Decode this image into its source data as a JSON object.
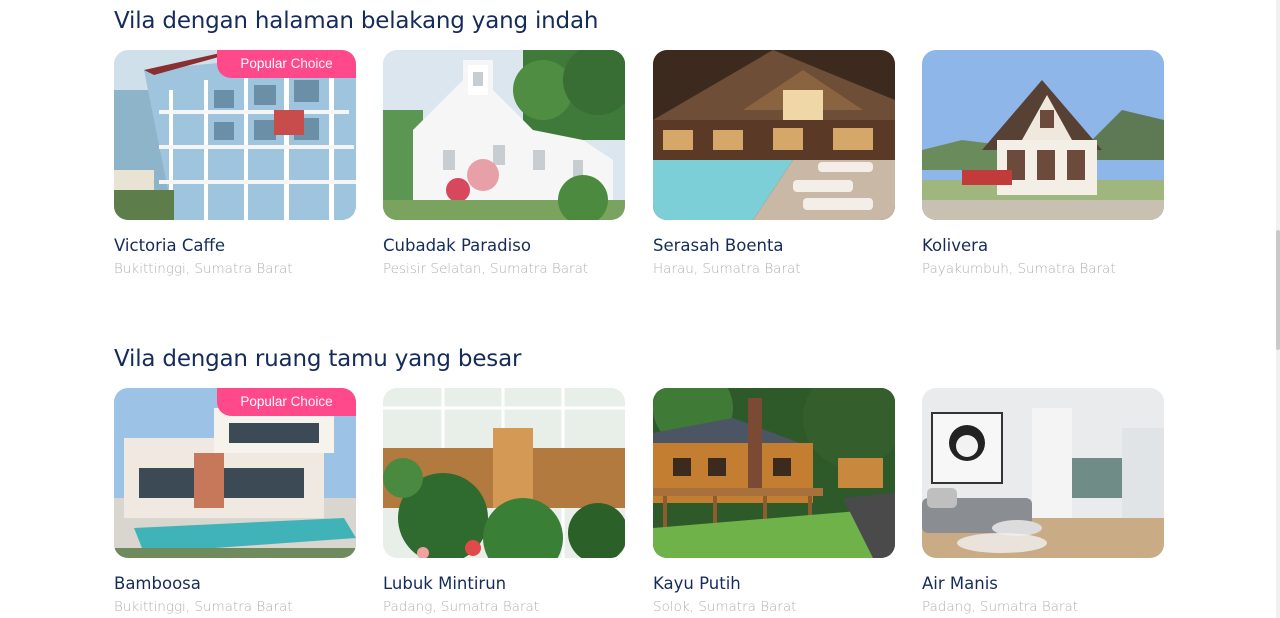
{
  "sections": [
    {
      "title": "Vila dengan halaman belakang yang indah",
      "items": [
        {
          "name": "Victoria Caffe",
          "location": "Bukittinggi, Sumatra Barat",
          "badge_main": "Popular",
          "badge_rest": "Choice"
        },
        {
          "name": "Cubadak Paradiso",
          "location": "Pesisir Selatan, Sumatra Barat"
        },
        {
          "name": "Serasah Boenta",
          "location": "Harau, Sumatra Barat"
        },
        {
          "name": "Kolivera",
          "location": "Payakumbuh, Sumatra Barat"
        }
      ]
    },
    {
      "title": "Vila dengan ruang tamu yang besar",
      "items": [
        {
          "name": "Bamboosa",
          "location": "Bukittinggi, Sumatra Barat",
          "badge_main": "Popular",
          "badge_rest": "Choice"
        },
        {
          "name": "Lubuk Mintirun",
          "location": "Padang, Sumatra Barat"
        },
        {
          "name": "Kayu Putih",
          "location": "Solok, Sumatra Barat"
        },
        {
          "name": "Air Manis",
          "location": "Padang, Sumatra Barat"
        }
      ]
    }
  ],
  "colors": {
    "title": "#152c5b",
    "subtitle": "#b0b0b0",
    "badge": "#ff498b"
  }
}
